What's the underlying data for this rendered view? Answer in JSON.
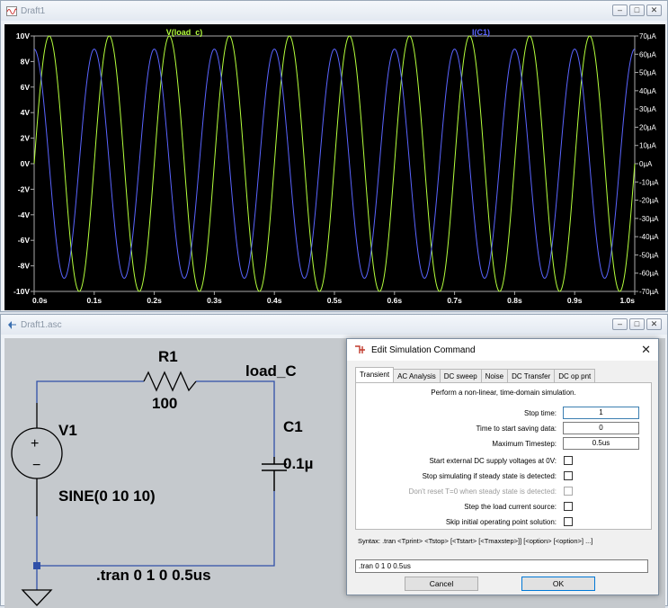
{
  "plot_window": {
    "title": "Draft1",
    "controls": [
      "–",
      "□",
      "✕"
    ]
  },
  "chart_data": {
    "type": "line",
    "x_ticks": [
      "0.0s",
      "0.1s",
      "0.2s",
      "0.3s",
      "0.4s",
      "0.5s",
      "0.6s",
      "0.7s",
      "0.8s",
      "0.9s",
      "1.0s"
    ],
    "xlim": [
      0,
      1
    ],
    "left_ticks": [
      "10V",
      "8V",
      "6V",
      "4V",
      "2V",
      "0V",
      "-2V",
      "-4V",
      "-6V",
      "-8V",
      "-10V"
    ],
    "ylim_left": [
      -10,
      10
    ],
    "right_ticks": [
      "70µA",
      "60µA",
      "50µA",
      "40µA",
      "30µA",
      "20µA",
      "10µA",
      "0µA",
      "-10µA",
      "-20µA",
      "-30µA",
      "-40µA",
      "-50µA",
      "-60µA",
      "-70µA"
    ],
    "ylim_right": [
      -70,
      70
    ],
    "series": [
      {
        "name": "V(load_c)",
        "axis": "left",
        "color": "#b4ff3c",
        "amplitude": 10,
        "frequency_hz": 10,
        "phase_deg": 0
      },
      {
        "name": "I(C1)",
        "axis": "right",
        "color": "#5a64ff",
        "amplitude": 62.8,
        "frequency_hz": 10,
        "phase_deg": 90
      }
    ],
    "background": "#000000",
    "grid": false
  },
  "schematic_window": {
    "title": "Draft1.asc",
    "controls": [
      "–",
      "□",
      "✕"
    ],
    "components": {
      "r1_name": "R1",
      "r1_value": "100",
      "net_label": "load_C",
      "c1_name": "C1",
      "c1_value": "0.1µ",
      "v1_name": "V1",
      "v1_value": "SINE(0 10 10)",
      "directive": ".tran 0 1 0 0.5us"
    }
  },
  "dialog": {
    "title": "Edit Simulation Command",
    "close": "✕",
    "tabs": [
      "Transient",
      "AC Analysis",
      "DC sweep",
      "Noise",
      "DC Transfer",
      "DC op pnt"
    ],
    "description": "Perform a non-linear, time-domain simulation.",
    "fields": [
      {
        "label": "Stop time:",
        "value": "1"
      },
      {
        "label": "Time to start saving data:",
        "value": "0"
      },
      {
        "label": "Maximum Timestep:",
        "value": "0.5us"
      }
    ],
    "checks": [
      {
        "label": "Start external DC supply voltages at 0V:"
      },
      {
        "label": "Stop simulating if steady state is detected:"
      },
      {
        "label": "Don't reset T=0 when steady state is detected:"
      },
      {
        "label": "Step the load current source:"
      },
      {
        "label": "Skip initial operating point solution:"
      }
    ],
    "syntax": "Syntax:  .tran <Tprint> <Tstop> [<Tstart> [<Tmaxstep>]] [<option> [<option>] ...]",
    "command": ".tran 0 1 0 0.5us",
    "cancel": "Cancel",
    "ok": "OK"
  }
}
